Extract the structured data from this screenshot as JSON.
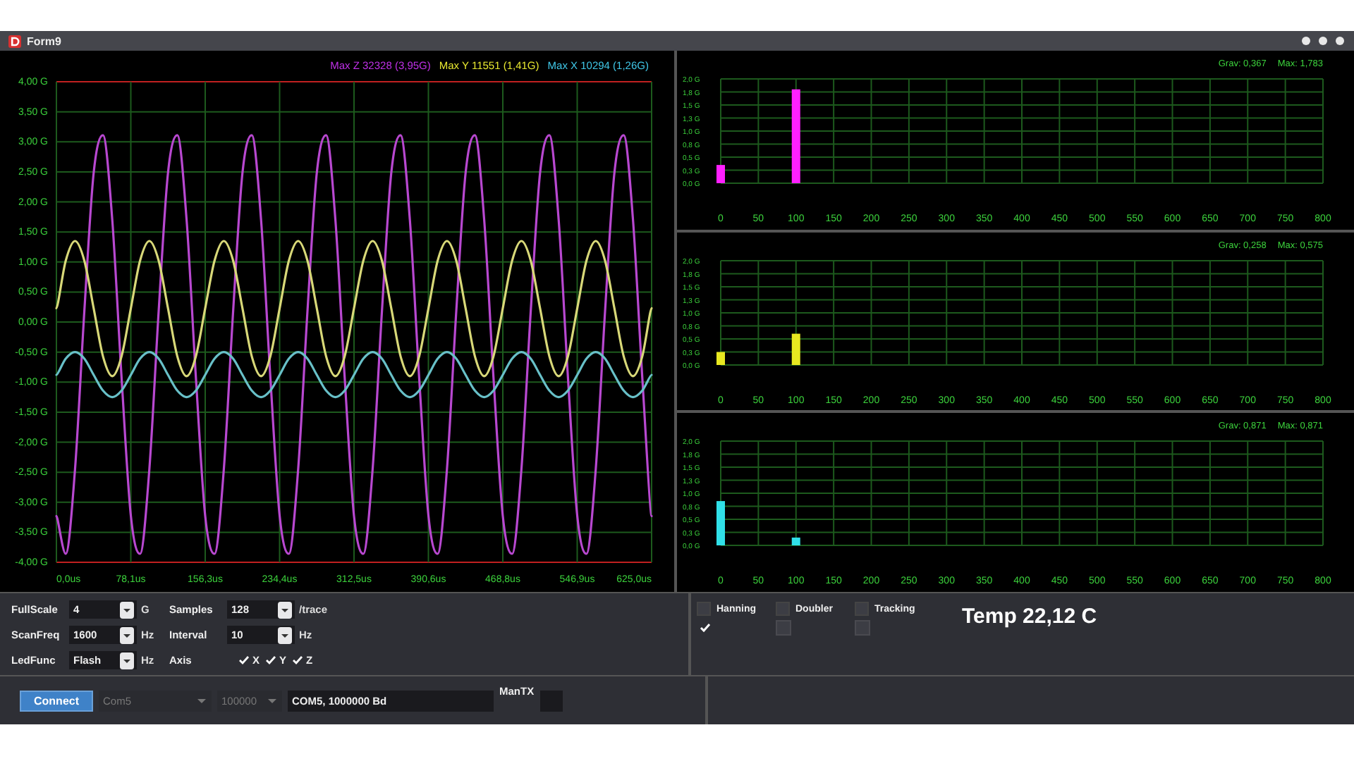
{
  "window": {
    "title": "Form9"
  },
  "waveform": {
    "legend": [
      {
        "label": "Max Z 32328 (3,95G)",
        "color": "#c030e8"
      },
      {
        "label": "Max Y 11551 (1,41G)",
        "color": "#e8e830"
      },
      {
        "label": "Max X 10294 (1,26G)",
        "color": "#40c8e8"
      }
    ],
    "chart_data": {
      "type": "line",
      "grid": true,
      "xlim": [
        0,
        625
      ],
      "ylim": [
        -4,
        4
      ],
      "x": [
        0,
        9.77,
        19.53,
        29.3,
        39.06,
        48.83,
        58.59,
        68.36,
        78.13,
        87.89,
        97.66,
        107.42,
        117.19,
        126.95,
        136.72,
        146.48,
        156.25,
        166.02,
        175.78,
        185.55,
        195.31,
        205.08,
        214.84,
        224.61,
        234.38,
        244.14,
        253.91,
        263.67,
        273.44,
        283.2,
        292.97,
        302.73,
        312.5,
        322.27,
        332.03,
        341.8,
        351.56,
        361.33,
        371.09,
        380.86,
        390.63,
        400.39,
        410.16,
        419.92,
        429.69,
        439.45,
        449.22,
        458.98,
        468.75,
        478.52,
        488.28,
        498.05,
        507.81,
        517.58,
        527.34,
        537.11,
        546.88,
        556.64,
        566.41,
        576.17,
        585.94,
        595.7,
        605.47,
        615.23,
        625
      ],
      "xticks": [
        {
          "value": 0,
          "label": "0,0us"
        },
        {
          "value": 78.13,
          "label": "78,1us"
        },
        {
          "value": 156.25,
          "label": "156,3us"
        },
        {
          "value": 234.38,
          "label": "234,4us"
        },
        {
          "value": 312.5,
          "label": "312,5us"
        },
        {
          "value": 390.63,
          "label": "390,6us"
        },
        {
          "value": 468.75,
          "label": "468,8us"
        },
        {
          "value": 546.88,
          "label": "546,9us"
        },
        {
          "value": 625,
          "label": "625,0us"
        }
      ],
      "yticks": [
        {
          "value": 4,
          "label": "4,00 G"
        },
        {
          "value": 3.5,
          "label": "3,50 G"
        },
        {
          "value": 3,
          "label": "3,00 G"
        },
        {
          "value": 2.5,
          "label": "2,50 G"
        },
        {
          "value": 2,
          "label": "2,00 G"
        },
        {
          "value": 1.5,
          "label": "1,50 G"
        },
        {
          "value": 1,
          "label": "1,00 G"
        },
        {
          "value": 0.5,
          "label": "0,50 G"
        },
        {
          "value": 0,
          "label": "0,00 G"
        },
        {
          "value": -0.5,
          "label": "-0,50 G"
        },
        {
          "value": -1,
          "label": "-1,00 G"
        },
        {
          "value": -1.5,
          "label": "-1,50 G"
        },
        {
          "value": -2,
          "label": "-2,00 G"
        },
        {
          "value": -2.5,
          "label": "-2,50 G"
        },
        {
          "value": -3,
          "label": "-3,00 G"
        },
        {
          "value": -3.5,
          "label": "-3,50 G"
        },
        {
          "value": -4,
          "label": "-4,00 G"
        }
      ],
      "series": [
        {
          "color": "#b848d0",
          "values": [
            -3.23,
            -3.86,
            -2.45,
            0.18,
            2.48,
            3.11,
            1.7,
            -0.93,
            -3.23,
            -3.86,
            -2.45,
            0.18,
            2.48,
            3.11,
            1.7,
            -0.93,
            -3.23,
            -3.86,
            -2.45,
            0.18,
            2.48,
            3.11,
            1.7,
            -0.93,
            -3.23,
            -3.86,
            -2.45,
            0.18,
            2.48,
            3.11,
            1.7,
            -0.93,
            -3.23,
            -3.86,
            -2.45,
            0.18,
            2.48,
            3.11,
            1.7,
            -0.93,
            -3.23,
            -3.86,
            -2.45,
            0.18,
            2.48,
            3.11,
            1.7,
            -0.93,
            -3.23,
            -3.86,
            -2.45,
            0.18,
            2.48,
            3.11,
            1.7,
            -0.93,
            -3.23,
            -3.86,
            -2.45,
            0.18,
            2.48,
            3.11,
            1.7,
            -0.93,
            -3.23
          ]
        },
        {
          "color": "#d8d878",
          "values": [
            0.23,
            1.02,
            1.35,
            1.02,
            0.23,
            -0.57,
            -0.9,
            -0.57,
            0.23,
            1.02,
            1.35,
            1.02,
            0.23,
            -0.57,
            -0.9,
            -0.57,
            0.23,
            1.02,
            1.35,
            1.02,
            0.23,
            -0.57,
            -0.9,
            -0.57,
            0.23,
            1.02,
            1.35,
            1.02,
            0.23,
            -0.57,
            -0.9,
            -0.57,
            0.23,
            1.02,
            1.35,
            1.02,
            0.23,
            -0.57,
            -0.9,
            -0.57,
            0.23,
            1.02,
            1.35,
            1.02,
            0.23,
            -0.57,
            -0.9,
            -0.57,
            0.23,
            1.02,
            1.35,
            1.02,
            0.23,
            -0.57,
            -0.9,
            -0.57,
            0.23,
            1.02,
            1.35,
            1.02,
            0.23,
            -0.57,
            -0.9,
            -0.57,
            0.23
          ]
        },
        {
          "color": "#68c0c8",
          "values": [
            -0.88,
            -0.61,
            -0.5,
            -0.61,
            -0.88,
            -1.14,
            -1.25,
            -1.14,
            -0.88,
            -0.61,
            -0.5,
            -0.61,
            -0.88,
            -1.14,
            -1.25,
            -1.14,
            -0.88,
            -0.61,
            -0.5,
            -0.61,
            -0.88,
            -1.14,
            -1.25,
            -1.14,
            -0.88,
            -0.61,
            -0.5,
            -0.61,
            -0.88,
            -1.14,
            -1.25,
            -1.14,
            -0.88,
            -0.61,
            -0.5,
            -0.61,
            -0.88,
            -1.14,
            -1.25,
            -1.14,
            -0.88,
            -0.61,
            -0.5,
            -0.61,
            -0.88,
            -1.14,
            -1.25,
            -1.14,
            -0.88,
            -0.61,
            -0.5,
            -0.61,
            -0.88,
            -1.14,
            -1.25,
            -1.14,
            -0.88,
            -0.61,
            -0.5,
            -0.61,
            -0.88,
            -1.14,
            -1.25,
            -1.14,
            -0.88
          ]
        }
      ]
    }
  },
  "spectra": [
    {
      "grav": "Grav: 0,367",
      "max": "Max: 1,783",
      "chart_data": {
        "type": "bar",
        "grid": true,
        "categories": [
          "0",
          "50",
          "100",
          "150",
          "200",
          "250",
          "300",
          "350",
          "400",
          "450",
          "500",
          "550",
          "600",
          "650",
          "700",
          "750",
          "800"
        ],
        "ylim": [
          0,
          2
        ],
        "yticks": [
          {
            "value": 2,
            "label": "2,0 G"
          },
          {
            "value": 1.75,
            "label": "1,8 G"
          },
          {
            "value": 1.5,
            "label": "1,5 G"
          },
          {
            "value": 1.25,
            "label": "1,3 G"
          },
          {
            "value": 1,
            "label": "1,0 G"
          },
          {
            "value": 0.75,
            "label": "0,8 G"
          },
          {
            "value": 0.5,
            "label": "0,5 G"
          },
          {
            "value": 0.25,
            "label": "0,3 G"
          },
          {
            "value": 0,
            "label": "0,0 G"
          }
        ],
        "series": [
          {
            "color": "#ff20ff",
            "values": [
              0.35,
              null,
              1.8,
              null,
              null,
              null,
              null,
              null,
              null,
              null,
              null,
              null,
              null,
              null,
              null,
              null,
              null
            ]
          }
        ]
      }
    },
    {
      "grav": "Grav: 0,258",
      "max": "Max: 0,575",
      "chart_data": {
        "type": "bar",
        "grid": true,
        "categories": [
          "0",
          "50",
          "100",
          "150",
          "200",
          "250",
          "300",
          "350",
          "400",
          "450",
          "500",
          "550",
          "600",
          "650",
          "700",
          "750",
          "800"
        ],
        "ylim": [
          0,
          2
        ],
        "yticks": [
          {
            "value": 2,
            "label": "2,0 G"
          },
          {
            "value": 1.75,
            "label": "1,8 G"
          },
          {
            "value": 1.5,
            "label": "1,5 G"
          },
          {
            "value": 1.25,
            "label": "1,3 G"
          },
          {
            "value": 1,
            "label": "1,0 G"
          },
          {
            "value": 0.75,
            "label": "0,8 G"
          },
          {
            "value": 0.5,
            "label": "0,5 G"
          },
          {
            "value": 0.25,
            "label": "0,3 G"
          },
          {
            "value": 0,
            "label": "0,0 G"
          }
        ],
        "series": [
          {
            "color": "#e8e820",
            "values": [
              0.25,
              null,
              0.6,
              null,
              null,
              null,
              null,
              null,
              null,
              null,
              null,
              null,
              null,
              null,
              null,
              null,
              null
            ]
          }
        ]
      }
    },
    {
      "grav": "Grav: 0,871",
      "max": "Max: 0,871",
      "chart_data": {
        "type": "bar",
        "grid": true,
        "categories": [
          "0",
          "50",
          "100",
          "150",
          "200",
          "250",
          "300",
          "350",
          "400",
          "450",
          "500",
          "550",
          "600",
          "650",
          "700",
          "750",
          "800"
        ],
        "ylim": [
          0,
          2
        ],
        "yticks": [
          {
            "value": 2,
            "label": "2,0 G"
          },
          {
            "value": 1.75,
            "label": "1,8 G"
          },
          {
            "value": 1.5,
            "label": "1,5 G"
          },
          {
            "value": 1.25,
            "label": "1,3 G"
          },
          {
            "value": 1,
            "label": "1,0 G"
          },
          {
            "value": 0.75,
            "label": "0,8 G"
          },
          {
            "value": 0.5,
            "label": "0,5 G"
          },
          {
            "value": 0.25,
            "label": "0,3 G"
          },
          {
            "value": 0,
            "label": "0,0 G"
          }
        ],
        "series": [
          {
            "color": "#30e0e8",
            "values": [
              0.85,
              null,
              0.15,
              null,
              null,
              null,
              null,
              null,
              null,
              null,
              null,
              null,
              null,
              null,
              null,
              null,
              null
            ]
          }
        ]
      }
    }
  ],
  "settings": [
    {
      "kind": "dropdown",
      "label": "FullScale",
      "value": "4",
      "unit": "G"
    },
    {
      "kind": "dropdown",
      "label": "Samples",
      "value": "128",
      "unit": "/trace"
    },
    {
      "kind": "dropdown",
      "label": "ScanFreq",
      "value": "1600",
      "unit": "Hz"
    },
    {
      "kind": "dropdown",
      "label": "Interval",
      "value": "10",
      "unit": "Hz"
    },
    {
      "kind": "dropdown",
      "label": "LedFunc",
      "value": "Flash",
      "unit": "Hz"
    },
    {
      "kind": "checks",
      "label": "Axis",
      "items": [
        {
          "label": "X",
          "checked": true
        },
        {
          "label": "Y",
          "checked": true
        },
        {
          "label": "Z",
          "checked": true
        }
      ]
    }
  ],
  "options": [
    {
      "label": "Hanning",
      "checked": true
    },
    {
      "label": "Doubler",
      "checked": false
    },
    {
      "label": "Tracking",
      "checked": false
    }
  ],
  "temperature": "Temp 22,12 C",
  "connection": {
    "button": "Connect",
    "port": {
      "value": "Com5",
      "disabled": true
    },
    "baud": {
      "value": "100000",
      "disabled": true
    },
    "status": "COM5, 1000000 Bd",
    "mantx_label": "ManTX"
  }
}
